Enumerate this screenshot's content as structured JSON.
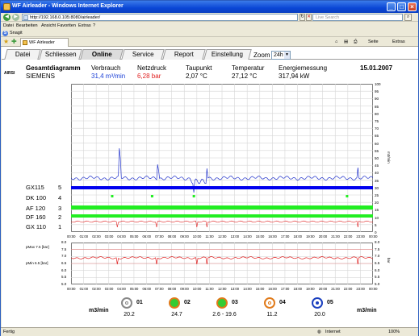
{
  "window": {
    "title": "WF Airleader - Windows Internet Explorer",
    "address": "http://192.168.0.105:8080/airleader/",
    "search_placeholder": "Live Search",
    "favorite_tab": "WF Airleader",
    "links_label": "Snagit",
    "menu": [
      "Datei",
      "Bearbeiten",
      "Ansicht",
      "Favoriten",
      "Extras",
      "?"
    ],
    "cmd": [
      "Seite",
      "Extras"
    ]
  },
  "tabs": [
    "Datei",
    "Schliessen",
    "Online",
    "Service",
    "Report",
    "Einstellung"
  ],
  "active_tab": "Online",
  "zoom": {
    "label": "Zoom",
    "value": "24h"
  },
  "side_label": "AIRSI",
  "summary": {
    "title": "Gesamtdiagramm",
    "subtitle": "SIEMENS",
    "verbrauch_label": "Verbrauch",
    "verbrauch_value": "31,4 m³/min",
    "netzdruck_label": "Netzdruck",
    "netzdruck_value": "6,28 bar",
    "taupunkt_label": "Taupunkt",
    "taupunkt_value": "2,07 °C",
    "temperatur_label": "Temperatur",
    "temperatur_value": "27,12 °C",
    "energie_label": "Energiemessung",
    "energie_value": "317,94 kW",
    "date": "15.01.2007"
  },
  "rows": [
    {
      "label": "GX115",
      "num": "5"
    },
    {
      "label": "DK 100",
      "num": "4"
    },
    {
      "label": "AF 120",
      "num": "3"
    },
    {
      "label": "DF 160",
      "num": "2"
    },
    {
      "label": "GX 110",
      "num": "1"
    }
  ],
  "top_right_ticks": [
    "100",
    "95",
    "90",
    "85",
    "80",
    "75",
    "70",
    "65",
    "60",
    "55",
    "50",
    "45",
    "40",
    "35",
    "30",
    "25",
    "20",
    "15",
    "10",
    "5",
    "0"
  ],
  "top_right_unit": "m3/min",
  "time_ticks": [
    "00:00",
    "01:00",
    "02:00",
    "03:00",
    "04:00",
    "05:00",
    "06:00",
    "07:00",
    "08:00",
    "09:00",
    "10:00",
    "11:00",
    "12:00",
    "13:00",
    "14:00",
    "15:00",
    "16:00",
    "17:00",
    "18:00",
    "19:00",
    "20:00",
    "21:00",
    "22:00",
    "23:00",
    "00:00"
  ],
  "pressure": {
    "pmax_label": "pMax 7.5 [bar]",
    "pmin_label": "pMin 6.5 [bar]",
    "ticks": [
      "8.0",
      "7.5",
      "7.0",
      "6.5",
      "6.0",
      "5.5",
      "5.0"
    ],
    "unit": "bar"
  },
  "footer": {
    "left_unit": "m3/min",
    "right_unit": "m3/min",
    "items": [
      {
        "num": "01",
        "value": "20.2",
        "fill": "#ffffff",
        "ring": "#888888"
      },
      {
        "num": "02",
        "value": "24.7",
        "fill": "#33cc33",
        "ring": "#e07a1a"
      },
      {
        "num": "03",
        "value": "2.6 - 19.6",
        "fill": "#33cc33",
        "ring": "#e07a1a"
      },
      {
        "num": "04",
        "value": "11.2",
        "fill": "#ffffff",
        "ring": "#e07a1a"
      },
      {
        "num": "05",
        "value": "20.0",
        "fill": "#ffffff",
        "ring": "#1a3fbf"
      }
    ]
  },
  "status": {
    "left": "Fertig",
    "zone": "Internet",
    "zoom": "100%"
  },
  "colors": {
    "blue_series": "#2233cc",
    "red_series": "#e02020",
    "green_bar": "#22ee22",
    "blue_bar": "#0000ee"
  }
}
